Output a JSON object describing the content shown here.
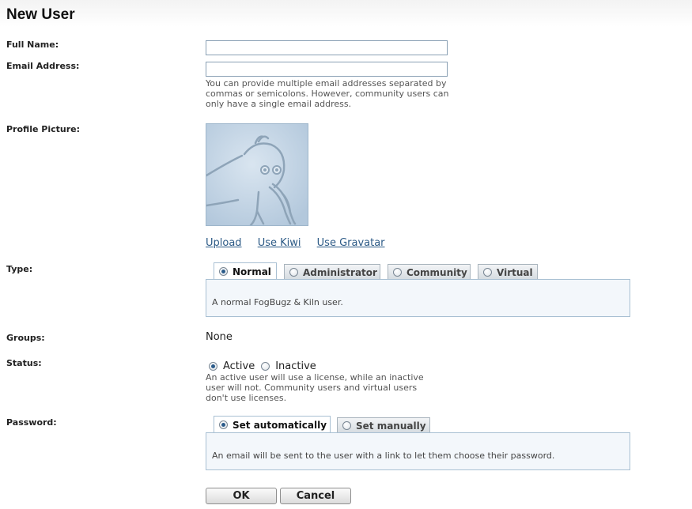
{
  "page": {
    "title": "New User"
  },
  "fields": {
    "full_name": {
      "label": "Full Name:",
      "value": ""
    },
    "email": {
      "label": "Email Address:",
      "value": "",
      "help": "You can provide multiple email addresses separated by commas or semicolons. However, community users can only have a single email address."
    },
    "profile_picture": {
      "label": "Profile Picture:",
      "links": {
        "upload": "Upload",
        "use_kiwi": "Use Kiwi",
        "use_gravatar": "Use Gravatar"
      }
    },
    "type": {
      "label": "Type:",
      "tabs": [
        "Normal",
        "Administrator",
        "Community",
        "Virtual"
      ],
      "selected": "Normal",
      "description": "A normal FogBugz & Kiln user."
    },
    "groups": {
      "label": "Groups:",
      "value": "None"
    },
    "status": {
      "label": "Status:",
      "options": [
        "Active",
        "Inactive"
      ],
      "selected": "Active",
      "help": "An active user will use a license, while an inactive user will not. Community users and virtual users don't use licenses."
    },
    "password": {
      "label": "Password:",
      "tabs": [
        "Set automatically",
        "Set manually"
      ],
      "selected": "Set automatically",
      "description": "An email will be sent to the user with a link to let them choose their password."
    }
  },
  "buttons": {
    "ok": "OK",
    "cancel": "Cancel"
  },
  "icons": {
    "avatar": "kiwi-bird-avatar",
    "radio": "radio-button"
  },
  "colors": {
    "link": "#2c5a86",
    "panel_bg": "#f3f7fb",
    "panel_border": "#a9c0d3",
    "avatar_bg": "#b9cde0"
  }
}
